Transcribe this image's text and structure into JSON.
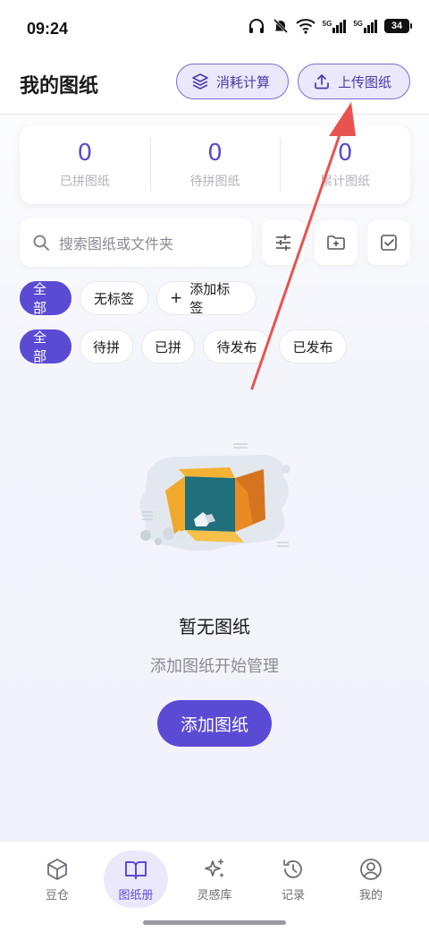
{
  "status_bar": {
    "time": "09:24",
    "battery": "34",
    "network1": "5G",
    "network2": "5G"
  },
  "header": {
    "title": "我的图纸",
    "calc_button": "消耗计算",
    "upload_button": "上传图纸"
  },
  "stats": [
    {
      "value": "0",
      "label": "已拼图纸"
    },
    {
      "value": "0",
      "label": "待拼图纸"
    },
    {
      "value": "0",
      "label": "累计图纸"
    }
  ],
  "search": {
    "placeholder": "搜索图纸或文件夹"
  },
  "tag_chips": [
    {
      "label": "全部",
      "active": true
    },
    {
      "label": "无标签",
      "active": false
    },
    {
      "label": "添加标签",
      "active": false
    }
  ],
  "status_chips": [
    {
      "label": "全部",
      "active": true
    },
    {
      "label": "待拼",
      "active": false
    },
    {
      "label": "已拼",
      "active": false
    },
    {
      "label": "待发布",
      "active": false
    },
    {
      "label": "已发布",
      "active": false
    }
  ],
  "empty_state": {
    "title": "暂无图纸",
    "subtitle": "添加图纸开始管理",
    "button": "添加图纸"
  },
  "bottom_nav": [
    {
      "label": "豆仓",
      "icon": "cube-icon",
      "active": false
    },
    {
      "label": "图纸册",
      "icon": "book-icon",
      "active": true
    },
    {
      "label": "灵感库",
      "icon": "sparkle-icon",
      "active": false
    },
    {
      "label": "记录",
      "icon": "history-icon",
      "active": false
    },
    {
      "label": "我的",
      "icon": "user-icon",
      "active": false
    }
  ],
  "colors": {
    "accent": "#5b4bd4",
    "accent_light": "#ece8fb",
    "annotation": "#e8534f"
  }
}
